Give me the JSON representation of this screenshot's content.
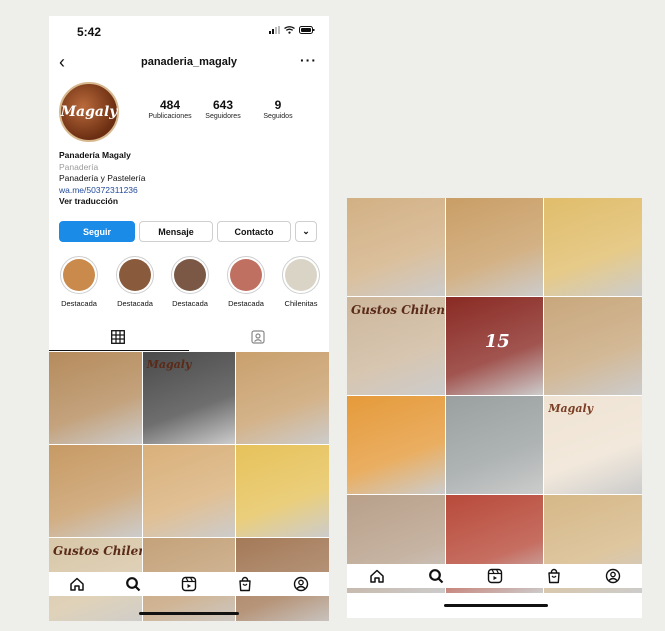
{
  "status": {
    "time": "5:42"
  },
  "header": {
    "back_glyph": "‹",
    "username": "panaderia_magaly",
    "more_glyph": "···"
  },
  "avatar": {
    "text": "Magaly"
  },
  "stats": [
    {
      "value": "484",
      "label": "Publicaciones"
    },
    {
      "value": "643",
      "label": "Seguidores"
    },
    {
      "value": "9",
      "label": "Seguidos"
    }
  ],
  "bio": {
    "name": "Panadería Magaly",
    "category": "Panadería",
    "description": "Panadería y Pastelería",
    "link": "wa.me/50372311236",
    "translate": "Ver traducción"
  },
  "buttons": {
    "follow": "Seguir",
    "message": "Mensaje",
    "contact": "Contacto",
    "dropdown": "⌄"
  },
  "highlights": [
    {
      "label": "Destacada",
      "color": "#c98a4b"
    },
    {
      "label": "Destacada",
      "color": "#8a5a3c"
    },
    {
      "label": "Destacada",
      "color": "#7a5845"
    },
    {
      "label": "Destacada",
      "color": "#c07060"
    },
    {
      "label": "Chilenitas",
      "color": "#d9d4c6"
    }
  ],
  "tabs": {
    "grid_icon": "grid-icon",
    "tagged_icon": "tagged-icon"
  },
  "posts_left": [
    {
      "color": "#b58b5c",
      "text": ""
    },
    {
      "color": "#4a4a4a",
      "text": "Magaly"
    },
    {
      "color": "#c9a06d",
      "text": ""
    },
    {
      "color": "#c79a64",
      "text": ""
    },
    {
      "color": "#d9b07a",
      "text": ""
    },
    {
      "color": "#e6c25a",
      "text": ""
    },
    {
      "color": "#d8c7a8",
      "text": "Gustos Chilenit"
    },
    {
      "color": "#c4a27a",
      "text": ""
    },
    {
      "color": "#a47a58",
      "text": ""
    }
  ],
  "posts_right": [
    {
      "color": "#d2b084",
      "text": ""
    },
    {
      "color": "#c99e66",
      "text": ""
    },
    {
      "color": "#e0bd6b",
      "text": ""
    },
    {
      "color": "#cdb79c",
      "text": "Gustos Chilenit"
    },
    {
      "color": "#8a2a24",
      "text": "15"
    },
    {
      "color": "#c8a77c",
      "text": ""
    },
    {
      "color": "#e59a3a",
      "text": ""
    },
    {
      "color": "#9aa0a0",
      "text": ""
    },
    {
      "color": "#efe3d3",
      "text": "Magaly"
    },
    {
      "color": "#b8a08a",
      "text": ""
    },
    {
      "color": "#b84a3a",
      "text": ""
    },
    {
      "color": "#d6b888",
      "text": ""
    }
  ],
  "nav_icons": [
    "home-icon",
    "search-icon",
    "reels-icon",
    "shop-icon",
    "profile-icon"
  ],
  "accent": "#1a8ce8"
}
